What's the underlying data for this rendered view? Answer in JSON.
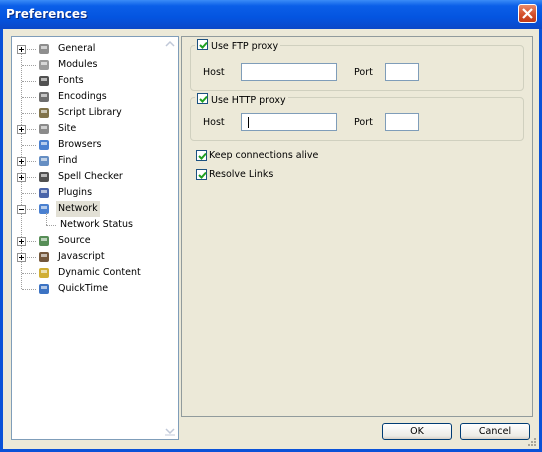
{
  "window": {
    "title": "Preferences"
  },
  "tree": {
    "items": [
      {
        "label": "General",
        "icon": "general-icon",
        "expander": "plus"
      },
      {
        "label": "Modules",
        "icon": "modules-icon",
        "expander": ""
      },
      {
        "label": "Fonts",
        "icon": "fonts-icon",
        "expander": ""
      },
      {
        "label": "Encodings",
        "icon": "encodings-icon",
        "expander": ""
      },
      {
        "label": "Script Library",
        "icon": "script-library-icon",
        "expander": ""
      },
      {
        "label": "Site",
        "icon": "site-icon",
        "expander": "plus"
      },
      {
        "label": "Browsers",
        "icon": "browsers-icon",
        "expander": ""
      },
      {
        "label": "Find",
        "icon": "find-icon",
        "expander": "plus"
      },
      {
        "label": "Spell Checker",
        "icon": "spell-checker-icon",
        "expander": "plus"
      },
      {
        "label": "Plugins",
        "icon": "plugins-icon",
        "expander": ""
      },
      {
        "label": "Network",
        "icon": "network-icon",
        "expander": "minus",
        "selected": true
      },
      {
        "label": "Network Status",
        "icon": "",
        "expander": "",
        "child": true
      },
      {
        "label": "Source",
        "icon": "source-icon",
        "expander": "plus"
      },
      {
        "label": "Javascript",
        "icon": "javascript-icon",
        "expander": "plus"
      },
      {
        "label": "Dynamic Content",
        "icon": "dynamic-content-icon",
        "expander": ""
      },
      {
        "label": "QuickTime",
        "icon": "quicktime-icon",
        "expander": ""
      }
    ]
  },
  "ftp": {
    "checkbox_label": "Use FTP proxy",
    "checked": true,
    "host_label": "Host",
    "host_value": "",
    "port_label": "Port",
    "port_value": ""
  },
  "http": {
    "checkbox_label": "Use HTTP proxy",
    "checked": true,
    "host_label": "Host",
    "host_value": "",
    "port_label": "Port",
    "port_value": ""
  },
  "options": [
    {
      "label": "Keep connections alive",
      "checked": true
    },
    {
      "label": "Resolve Links",
      "checked": true
    }
  ],
  "buttons": {
    "ok": "OK",
    "cancel": "Cancel"
  },
  "colors": {
    "title_bar": "#0454e0",
    "close_button": "#d4502c",
    "dialog_bg": "#ece9d8",
    "checkbox_check": "#21a121"
  }
}
